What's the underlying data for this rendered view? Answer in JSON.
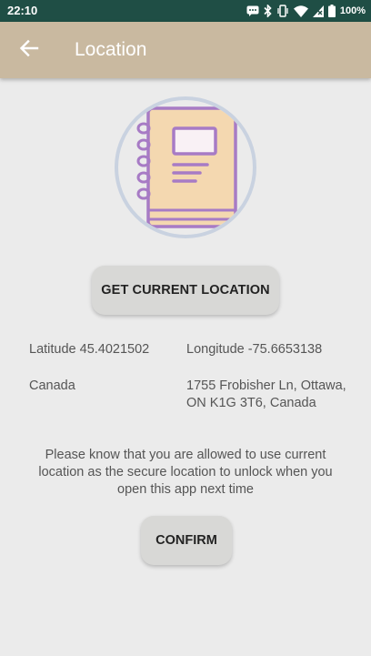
{
  "status_bar": {
    "time": "22:10",
    "battery": "100%",
    "icons": [
      "message-icon",
      "bluetooth-icon",
      "vibrate-icon",
      "wifi-icon",
      "signal-icon",
      "battery-icon"
    ]
  },
  "app_bar": {
    "title": "Location",
    "back_icon": "arrow-left-icon",
    "color": "#c9b9a0"
  },
  "main": {
    "illustration_icon": "notebook-icon",
    "get_location_label": "GET CURRENT LOCATION",
    "latitude_text": "Latitude 45.4021502",
    "longitude_text": "Longitude -75.6653138",
    "country": "Canada",
    "address": "1755 Frobisher Ln, Ottawa, ON K1G 3T6, Canada",
    "notice": "Please know that you are allowed to use current location as the secure location to unlock when you open this app next time",
    "confirm_label": "CONFIRM"
  },
  "colors": {
    "status_bar": "#1f4e45",
    "background": "#ebebeb",
    "button": "#d8d8d6",
    "illustration_outline": "#a77bc5",
    "illustration_fill": "#f4d8b0"
  }
}
